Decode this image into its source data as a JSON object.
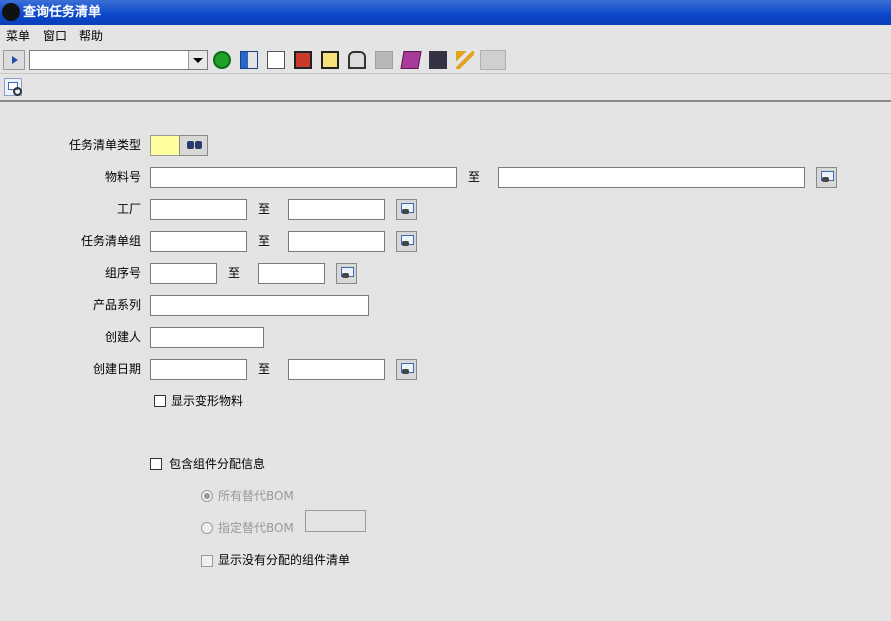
{
  "window": {
    "title": "查询任务清单"
  },
  "menu": {
    "items": [
      "菜单",
      "窗口",
      "帮助"
    ]
  },
  "toolbar": {
    "command_value": ""
  },
  "form": {
    "task_list_type": {
      "label": "任务清单类型",
      "value": ""
    },
    "material": {
      "label": "物料号",
      "from": "",
      "to": "",
      "to_label": "至"
    },
    "plant": {
      "label": "工厂",
      "from": "",
      "to": "",
      "to_label": "至"
    },
    "task_group": {
      "label": "任务清单组",
      "from": "",
      "to": "",
      "to_label": "至"
    },
    "group_counter": {
      "label": "组序号",
      "from": "",
      "to": "",
      "to_label": "至"
    },
    "product_series": {
      "label": "产品系列",
      "value": ""
    },
    "creator": {
      "label": "创建人",
      "value": ""
    },
    "created_date": {
      "label": "创建日期",
      "from": "",
      "to": "",
      "to_label": "至"
    },
    "show_variant_material": {
      "label": "显示变形物料",
      "checked": false
    },
    "include_component_alloc": {
      "label": "包含组件分配信息",
      "checked": false
    },
    "all_alt_bom": {
      "label": "所有替代BOM",
      "selected": true
    },
    "specified_alt_bom": {
      "label": "指定替代BOM",
      "selected": false,
      "value": ""
    },
    "show_unassigned": {
      "label": "显示没有分配的组件清单",
      "checked": false
    }
  }
}
